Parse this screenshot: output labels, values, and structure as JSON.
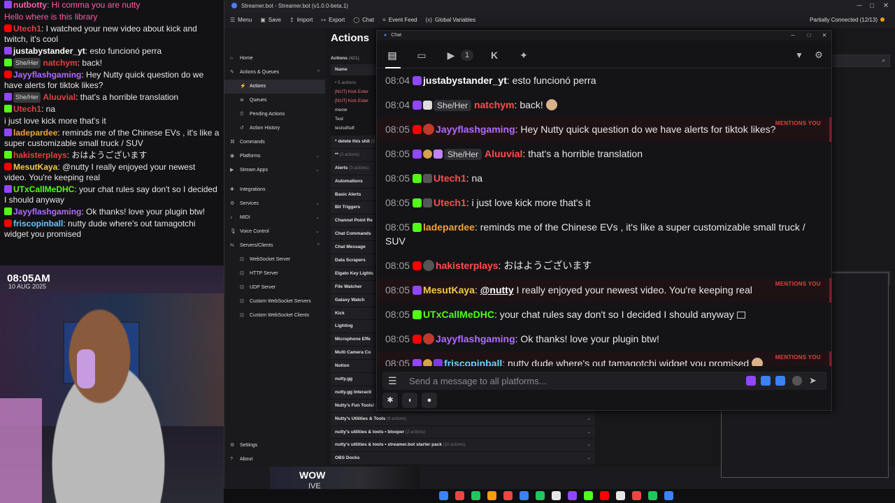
{
  "overlay_chat": {
    "lines": [
      {
        "user": "nutbotty",
        "text": ": Hi comma you are nutty",
        "user_color": "#ff5aa8",
        "text_color": "#ff5aa8"
      },
      {
        "system": "Hello where is this library"
      },
      {
        "user": "Utech1",
        "text": ": I watched your new video about kick and twitch, it's cool",
        "user_color": "#e0413f"
      },
      {
        "user": "justabystander_yt",
        "text": ": esto funcionó perra",
        "user_color": "#ffffff"
      },
      {
        "user": "natchym",
        "pill": "She/Her",
        "text": ": back!",
        "user_color": "#e0413f"
      },
      {
        "user": "Jayyflashgaming",
        "text": ": Hey Nutty quick question do we have alerts for tiktok likes?",
        "user_color": "#b06bff"
      },
      {
        "user": "Aluuvial",
        "pill": "She/Her",
        "text": ": that's a horrible translation",
        "user_color": "#e0413f"
      },
      {
        "user": "Utech1",
        "text": ": na",
        "user_color": "#e0413f"
      },
      {
        "system_white": "i just love kick more that's it"
      },
      {
        "user": "ladepardee",
        "text": ": reminds me of the Chinese EVs , it's like a super customizable small truck / SUV",
        "user_color": "#f2a23a"
      },
      {
        "user": "hakisterplays",
        "text": ": おはようございます",
        "user_color": "#e0413f"
      },
      {
        "user": "MesutKaya",
        "text": ": @nutty I really enjoyed your newest video. You're keeping real",
        "user_color": "#f2c94c"
      },
      {
        "user": "UTxCallMeDHC",
        "text": ": your chat rules say don't so I decided I should anyway",
        "user_color": "#53fc18"
      },
      {
        "user": "Jayyflashgaming",
        "text": ": Ok thanks! love your plugin btw!",
        "user_color": "#b06bff"
      },
      {
        "user": "friscopinball",
        "text": ": nutty dude where's out tamagotchi widget you promised",
        "user_color": "#6bc6ff"
      }
    ]
  },
  "webcam": {
    "time": "08:05AM",
    "date": "10 AUG 2025"
  },
  "app": {
    "title": "Streamer.bot - Streamer.bot (v1.0.0-beta.1)",
    "menu": [
      {
        "icon": "☰",
        "label": "Menu"
      },
      {
        "icon": "▣",
        "label": "Save"
      },
      {
        "icon": "↥",
        "label": "Import"
      },
      {
        "icon": "↦",
        "label": "Export"
      },
      {
        "icon": "◯",
        "label": "Chat"
      },
      {
        "icon": "≡",
        "label": "Event Feed"
      },
      {
        "icon": "{x}",
        "label": "Global Variables"
      }
    ],
    "status": "Partially Connected (12/13)",
    "status_color": "#f59e0b"
  },
  "sidebar": {
    "items": [
      {
        "icon": "⌂",
        "label": "Home",
        "type": "top"
      },
      {
        "icon": "✎",
        "label": "Actions & Queues",
        "type": "group",
        "chev": "^"
      },
      {
        "icon": "⚡",
        "label": "Actions",
        "type": "sub",
        "active": true
      },
      {
        "icon": "≣",
        "label": "Queues",
        "type": "sub"
      },
      {
        "icon": "⏱",
        "label": "Pending Actions",
        "type": "sub"
      },
      {
        "icon": "↺",
        "label": "Action History",
        "type": "sub"
      },
      {
        "icon": "⌘",
        "label": "Commands",
        "type": "top"
      },
      {
        "icon": "◉",
        "label": "Platforms",
        "type": "top",
        "chev": "⌄"
      },
      {
        "icon": "▶",
        "label": "Stream Apps",
        "type": "top",
        "chev": "⌄"
      },
      {
        "icon": "✚",
        "label": "Integrations",
        "type": "top",
        "gap": true
      },
      {
        "icon": "⚙",
        "label": "Services",
        "type": "top",
        "chev": "⌄"
      },
      {
        "icon": "♪",
        "label": "MIDI",
        "type": "top",
        "chev": "⌄"
      },
      {
        "icon": "🎙",
        "label": "Voice Control",
        "type": "top",
        "chev": "⌄"
      },
      {
        "icon": "⇆",
        "label": "Servers/Clients",
        "type": "top",
        "chev": "^"
      },
      {
        "icon": "⊡",
        "label": "WebSocket Server",
        "type": "sub"
      },
      {
        "icon": "⊡",
        "label": "HTTP Server",
        "type": "sub"
      },
      {
        "icon": "⊡",
        "label": "UDP Server",
        "type": "sub"
      },
      {
        "icon": "⊡",
        "label": "Custom WebSocket Servers",
        "type": "sub"
      },
      {
        "icon": "⊡",
        "label": "Custom WebSocket Clients",
        "type": "sub"
      }
    ],
    "bottom": [
      {
        "icon": "⚙",
        "label": "Settings"
      },
      {
        "icon": "?",
        "label": "About"
      }
    ]
  },
  "actions": {
    "heading": "Actions",
    "count_label": "Actions",
    "count": "(421)",
    "col_name": "Name",
    "group0": "• 5 actions",
    "rows": [
      {
        "label": "[NUT] Kick Exter",
        "red": true
      },
      {
        "label": "[NUT] Kick Exter",
        "red": true
      },
      {
        "label": "meow"
      },
      {
        "label": "Test"
      },
      {
        "label": "testsdfsdf"
      }
    ],
    "delete_row": "* delete this shit",
    "delete_sub": "(3 actions)",
    "star_row": "**",
    "star_sub": "(3 actions)",
    "groups": [
      {
        "label": "Alerts",
        "sub": "(3 actions)"
      },
      {
        "label": "Automations",
        "sub": ""
      },
      {
        "label": "Basic Alerts",
        "sub": ""
      },
      {
        "label": "Bit Triggers",
        "sub": ""
      },
      {
        "label": "Channel Point Re",
        "sub": ""
      },
      {
        "label": "Chat Commands",
        "sub": ""
      },
      {
        "label": "Chat Message",
        "sub": ""
      },
      {
        "label": "Data Scrapers",
        "sub": ""
      },
      {
        "label": "Elgato Key Lights",
        "sub": ""
      },
      {
        "label": "File Watcher",
        "sub": ""
      },
      {
        "label": "Galaxy Watch",
        "sub": ""
      },
      {
        "label": "Kick",
        "sub": ""
      },
      {
        "label": "Lighting",
        "sub": ""
      },
      {
        "label": "Microphone Effe",
        "sub": ""
      },
      {
        "label": "Multi Camera Co",
        "sub": ""
      },
      {
        "label": "Notion",
        "sub": ""
      },
      {
        "label": "nutty.gg",
        "sub": ""
      },
      {
        "label": "nutty.gg Interacti",
        "sub": ""
      },
      {
        "label": "Nutty's Fun Tools!",
        "sub": "(5 actions)"
      },
      {
        "label": "Nutty's Utilities & Tools",
        "sub": "(9 actions)"
      },
      {
        "label": "nutty's utilities & tools • blooper",
        "sub": "(2 actions)"
      },
      {
        "label": "nutty's utilities & tools • streamer.bot starter pack",
        "sub": "(10 actions)"
      },
      {
        "label": "OBS Docks",
        "sub": ""
      }
    ]
  },
  "chat": {
    "title": "Chat",
    "yt_count": "1",
    "input_placeholder": "Send a message to all platforms...",
    "mentions_label": "MENTIONS YOU",
    "messages": [
      {
        "time": "08:04",
        "platform": "twitch",
        "user": "justabystander_yt",
        "user_color": "#ffffff",
        "text": ": esto funcionó perra"
      },
      {
        "time": "08:04",
        "platform": "twitch",
        "white_badge": true,
        "pill": "She/Her",
        "user": "natchym",
        "user_color": "#ff4d4d",
        "text": ": back!",
        "emote": true
      },
      {
        "time": "08:05",
        "platform": "youtube",
        "avatar": "#c0392b",
        "user": "Jayyflashgaming",
        "user_color": "#b06bff",
        "text": ": Hey Nutty quick question do we have alerts for tiktok likes?",
        "mentions": true
      },
      {
        "time": "08:05",
        "platform": "twitch",
        "coin": true,
        "gift": true,
        "pill": "She/Her",
        "user": "Aluuvial",
        "user_color": "#ff4d4d",
        "text": ": that's a horrible translation"
      },
      {
        "time": "08:05",
        "platform": "kick",
        "grey": true,
        "user": "Utech1",
        "user_color": "#ff4d4d",
        "text": ": na"
      },
      {
        "time": "08:05",
        "platform": "kick",
        "grey": true,
        "user": "Utech1",
        "user_color": "#ff4d4d",
        "text": ": i just love kick more that's it"
      },
      {
        "time": "08:05",
        "platform": "kick",
        "user": "ladepardee",
        "user_color": "#f2a23a",
        "text": ": reminds me of the Chinese EVs , it's like a super customizable small truck / SUV"
      },
      {
        "time": "08:05",
        "platform": "youtube",
        "avatar": "#555",
        "user": "hakisterplays",
        "user_color": "#ff4d4d",
        "text": ": おはようございます"
      },
      {
        "time": "08:05",
        "platform": "twitch",
        "user": "MesutKaya",
        "user_color": "#f2c94c",
        "text_pre": ": ",
        "mention_text": "@nutty",
        "text": " I really enjoyed your newest video. You're keeping real",
        "mentions": true
      },
      {
        "time": "08:05",
        "platform": "kick",
        "user": "UTxCallMeDHC",
        "user_color": "#53fc18",
        "text": ": your chat rules say don't so I decided I should anyway",
        "emote_box": true
      },
      {
        "time": "08:05",
        "platform": "youtube",
        "avatar": "#c0392b",
        "user": "Jayyflashgaming",
        "user_color": "#b06bff",
        "text": ": Ok thanks! love your plugin btw!"
      },
      {
        "time": "08:05",
        "platform": "twitch",
        "coin": true,
        "gift2": true,
        "user": "friscopinball",
        "user_color": "#6bd3ff",
        "text": ": nutty dude where's out tamagotchi widget you promised",
        "mentions": true,
        "emote": true
      }
    ]
  },
  "overlay_popup": {
    "title": "WOW",
    "sub": "IVE"
  },
  "colors": {
    "twitch": "#9146ff",
    "kick": "#53fc18",
    "youtube": "#ff0000"
  }
}
